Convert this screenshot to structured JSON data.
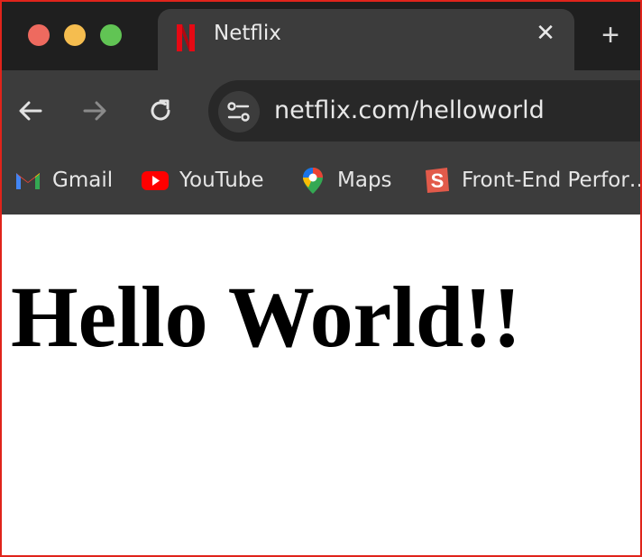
{
  "colors": {
    "frame_border": "#e0241b",
    "tabstrip_bg": "#1f1f1f",
    "toolbar_bg": "#3c3c3c",
    "omnibox_bg": "#282828",
    "netflix_red": "#e50914",
    "traffic_close": "#ee6a5f",
    "traffic_minimize": "#f5bd4f",
    "traffic_maximize": "#61c454"
  },
  "window": {
    "controls": [
      "close",
      "minimize",
      "maximize"
    ]
  },
  "tab": {
    "title": "Netflix",
    "favicon": "netflix-logo",
    "close_glyph": "✕"
  },
  "newtab": {
    "glyph": "+"
  },
  "toolbar": {
    "icons": [
      "back-arrow-icon",
      "forward-arrow-icon",
      "reload-icon",
      "site-info-icon"
    ],
    "url": "netflix.com/helloworld"
  },
  "bookmarks": [
    {
      "label": "Gmail",
      "icon": "gmail-icon"
    },
    {
      "label": "YouTube",
      "icon": "youtube-icon"
    },
    {
      "label": "Maps",
      "icon": "maps-icon"
    },
    {
      "label": "Front-End Perfor…",
      "icon": "bookmark-s-icon"
    }
  ],
  "page": {
    "heading": "Hello World!!"
  }
}
